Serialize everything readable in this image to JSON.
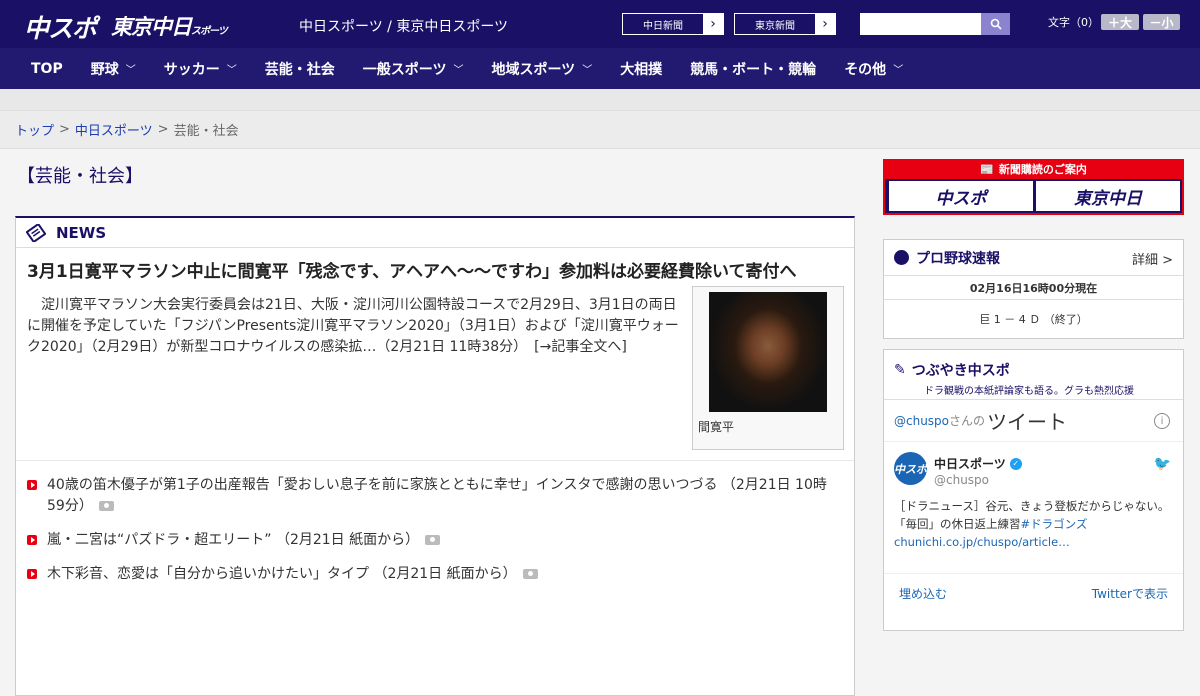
{
  "header": {
    "logo1": "中スポ",
    "logo2": "東京中日",
    "logo2_small": "スポーツ",
    "site_title": "中日スポーツ / 東京中日スポーツ",
    "paper1": "中日新聞",
    "paper2": "東京新聞",
    "search_placeholder": "",
    "font_label": "文字（0）",
    "font_plus": "＋大",
    "font_minus": "－小"
  },
  "nav": [
    "TOP",
    "野球",
    "サッカー",
    "芸能・社会",
    "一般スポーツ",
    "地域スポーツ",
    "大相撲",
    "競馬・ボート・競輪",
    "その他"
  ],
  "nav_has_chevron": [
    false,
    true,
    true,
    false,
    true,
    true,
    false,
    false,
    true
  ],
  "breadcrumb": {
    "home": "トップ",
    "section": "中日スポーツ",
    "current": "芸能・社会",
    "sep": ">"
  },
  "category_title": "【芸能・社会】",
  "news": {
    "heading": "NEWS",
    "headline": "3月1日寛平マラソン中止に間寛平「残念です、アヘアへ～～ですわ」参加料は必要経費除いて寄付へ",
    "lead": "　淀川寛平マラソン大会実行委員会は21日、大阪・淀川河川公園特設コースで2月29日、3月1日の両日に開催を予定していた「フジパンPresents淀川寛平マラソン2020」（3月1日）および「淀川寛平ウォーク2020」（2月29日）が新型コロナウイルスの感染拡…（2月21日 11時38分）　[→記事全文へ]",
    "photo_caption": "間寛平",
    "items": [
      "40歳の笛木優子が第1子の出産報告「愛おしい息子を前に家族とともに幸せ」インスタで感謝の思いつづる （2月21日 10時59分）",
      "嵐・二宮は“パズドラ・超エリート” （2月21日 紙面から）",
      "木下彩音、恋愛は「自分から追いかけたい」タイプ （2月21日 紙面から）"
    ]
  },
  "sidebar": {
    "subscribe_bar": "新聞購読のご案内",
    "sub_btn1": "中スポ",
    "sub_btn2": "東京中日",
    "baseball_title": "プロ野球速報",
    "baseball_more": "詳細 >",
    "baseball_time": "02月16日16時00分現在",
    "baseball_score": "巨  1 － 4  Ｄ  （終了）",
    "tw_title": "つぶやき中スポ",
    "tw_subtitle": "ドラ観戦の本紙評論家も語る。グラも熱烈応援",
    "tw_user": "@chuspo",
    "tw_san": "さんの",
    "tw_tweet": "ツイート",
    "tw_avatar": "中スポ",
    "tw_account": "中日スポーツ",
    "tw_handle": "@chuspo",
    "tw_text1": "［ドラニュース］谷元、きょう登板だからじゃない。「毎回」の休日返上練習",
    "tw_tag": "#ドラゴンズ",
    "tw_link": "chunichi.co.jp/chuspo/article…",
    "tw_embed": "埋め込む",
    "tw_view": "Twitterで表示"
  },
  "colors": {
    "navy": "#1a1066",
    "red": "#e60012",
    "link": "#1a66b4"
  }
}
